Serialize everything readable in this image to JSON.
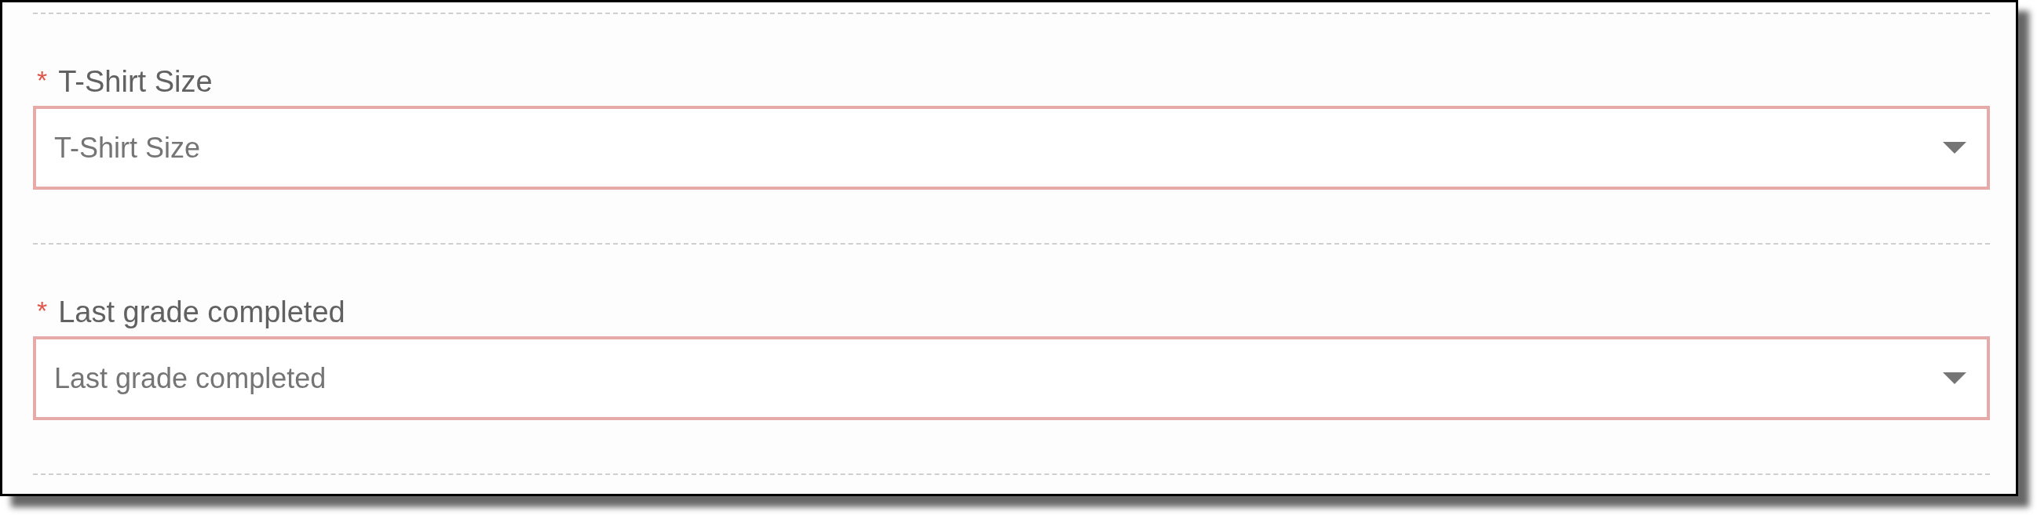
{
  "fields": [
    {
      "label": "T-Shirt Size",
      "required": true,
      "required_mark": "*",
      "placeholder": "T-Shirt Size",
      "error": true
    },
    {
      "label": "Last grade completed",
      "required": true,
      "required_mark": "*",
      "placeholder": "Last grade completed",
      "error": true
    }
  ]
}
